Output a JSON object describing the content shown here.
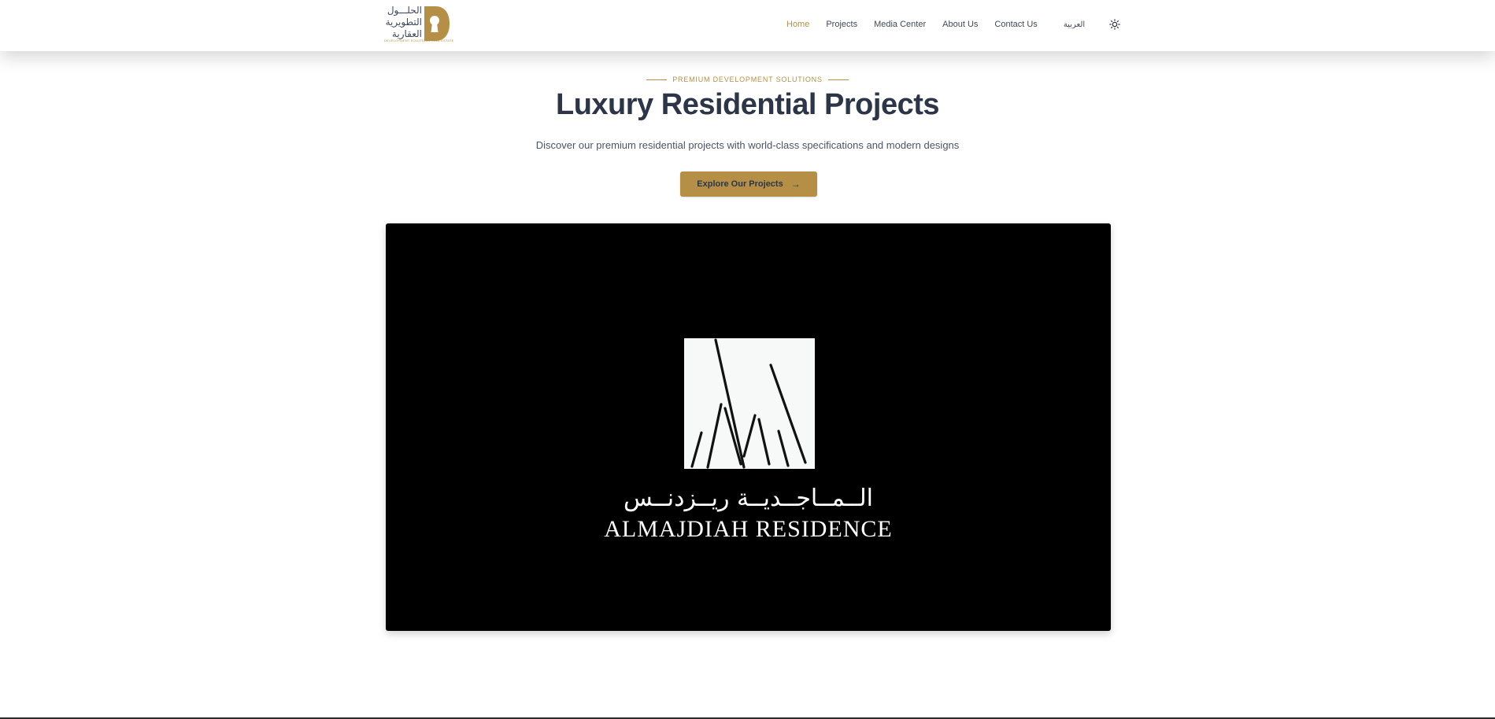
{
  "brand": {
    "name_ar_lines": [
      "الحلـــول",
      "التطويرية",
      "العقارية"
    ],
    "tagline": "DEVELOPMENT SOLUTIONS REAL ESTATE",
    "mark_letter": "D",
    "color": "#b48f45"
  },
  "nav": {
    "items": [
      {
        "label": "Home",
        "active": true
      },
      {
        "label": "Projects",
        "active": false
      },
      {
        "label": "Media Center",
        "active": false
      },
      {
        "label": "About Us",
        "active": false
      },
      {
        "label": "Contact Us",
        "active": false
      }
    ],
    "language_label": "العربية",
    "theme_icon": "sun-icon"
  },
  "hero": {
    "eyebrow": "PREMIUM DEVELOPMENT SOLUTIONS",
    "title": "Luxury Residential Projects",
    "subtitle": "Discover our premium residential projects with world-class specifications and modern designs",
    "cta_label": "Explore Our Projects",
    "cta_icon": "arrow-right-icon"
  },
  "media": {
    "name_ar": "الــمــاجــديــة ريــزدنــس",
    "name_en": "ALMAJDIAH RESIDENCE"
  },
  "colors": {
    "accent": "#b48f45",
    "heading": "#2d3649",
    "text": "#3f4a5c",
    "media_bg": "#000000"
  }
}
